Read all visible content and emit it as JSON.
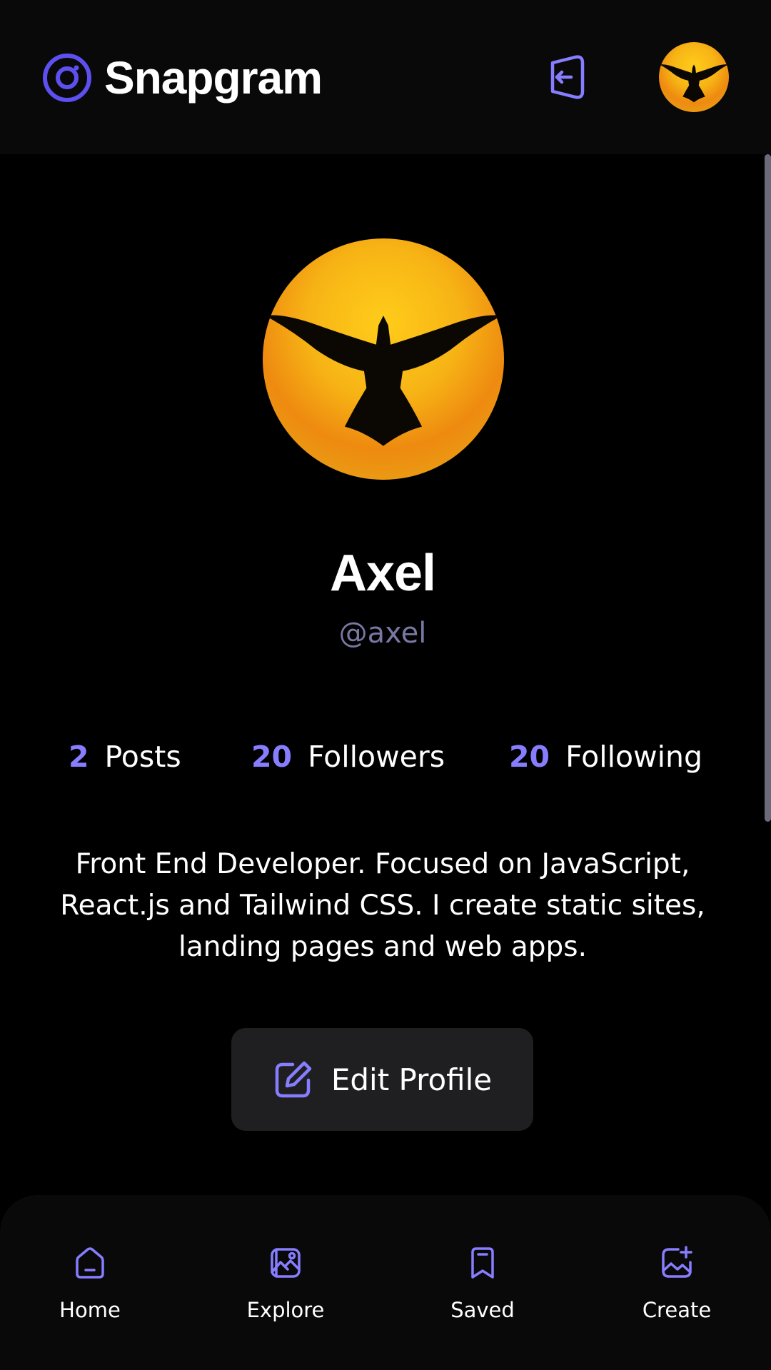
{
  "app": {
    "name": "Snapgram"
  },
  "colors": {
    "accent": "#877eff",
    "logo": "#5d50f0",
    "background": "#000000",
    "bar": "#09090a",
    "button": "#1f1f22",
    "handle": "#7878a3"
  },
  "header": {
    "logo_icon": "snapgram-logo-icon",
    "logout_icon": "logout-icon",
    "avatar_icon": "eagle-sun-avatar"
  },
  "profile": {
    "name": "Axel",
    "handle": "@axel",
    "stats": [
      {
        "value": "2",
        "label": "Posts"
      },
      {
        "value": "20",
        "label": "Followers"
      },
      {
        "value": "20",
        "label": "Following"
      }
    ],
    "bio": "Front End Developer. Focused on JavaScript, React.js and Tailwind CSS. I create static sites, landing pages and web apps.",
    "edit_label": "Edit Profile",
    "edit_icon": "edit-icon"
  },
  "bottom_nav": [
    {
      "label": "Home",
      "icon": "home-icon"
    },
    {
      "label": "Explore",
      "icon": "explore-icon"
    },
    {
      "label": "Saved",
      "icon": "bookmark-icon"
    },
    {
      "label": "Create",
      "icon": "create-image-icon"
    }
  ]
}
